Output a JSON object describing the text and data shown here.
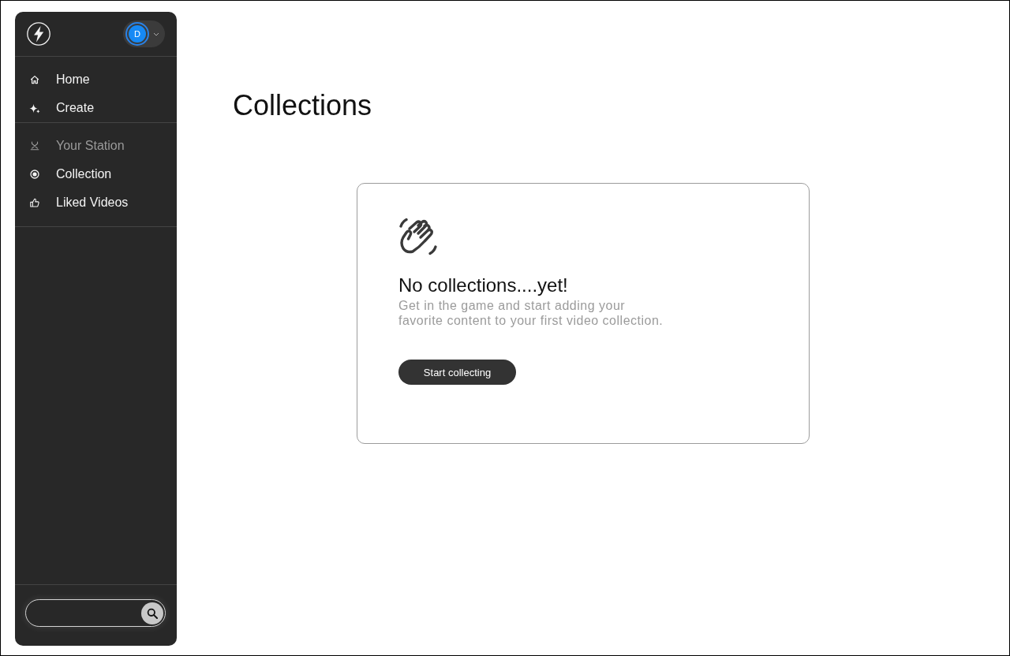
{
  "sidebar": {
    "account": {
      "initial": "D"
    },
    "nav_groups": [
      {
        "items": [
          {
            "label": "Home",
            "disabled": false
          },
          {
            "label": "Create",
            "disabled": false
          }
        ]
      },
      {
        "items": [
          {
            "label": "Your Station",
            "disabled": true
          },
          {
            "label": "Collection",
            "disabled": false
          },
          {
            "label": "Liked Videos",
            "disabled": false
          }
        ]
      }
    ]
  },
  "main": {
    "title": "Collections",
    "empty_state": {
      "heading": "No collections....yet!",
      "message": "Get in the game and start adding your favorite content to your first video collection.",
      "button": "Start collecting"
    }
  }
}
